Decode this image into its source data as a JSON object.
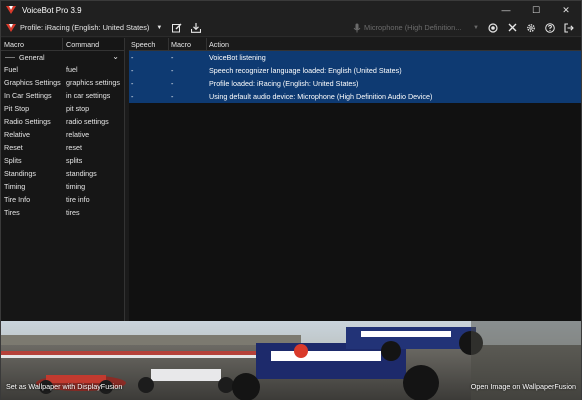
{
  "window": {
    "title": "VoiceBot Pro 3.9"
  },
  "window_controls": {
    "minimize": "—",
    "maximize": "☐",
    "close": "✕"
  },
  "toolbar": {
    "profile_label": "Profile: iRacing (English: United States)",
    "profile_caret": "▼",
    "microphone_label": "Microphone (High Definition...",
    "microphone_caret": "▼"
  },
  "macros": {
    "headers": {
      "macro": "Macro",
      "command": "Command"
    },
    "group": {
      "label": "General",
      "chevron": "⌄"
    },
    "rows": [
      {
        "macro": "Fuel",
        "command": "fuel"
      },
      {
        "macro": "Graphics Settings",
        "command": "graphics settings"
      },
      {
        "macro": "In Car Settings",
        "command": "in car settings"
      },
      {
        "macro": "Pit Stop",
        "command": "pit stop"
      },
      {
        "macro": "Radio Settings",
        "command": "radio settings"
      },
      {
        "macro": "Relative",
        "command": "relative"
      },
      {
        "macro": "Reset",
        "command": "reset"
      },
      {
        "macro": "Splits",
        "command": "splits"
      },
      {
        "macro": "Standings",
        "command": "standings"
      },
      {
        "macro": "Timing",
        "command": "timing"
      },
      {
        "macro": "Tire Info",
        "command": "tire info"
      },
      {
        "macro": "Tires",
        "command": "tires"
      }
    ]
  },
  "log": {
    "headers": {
      "speech": "Speech",
      "macro": "Macro",
      "action": "Action"
    },
    "rows": [
      {
        "speech": "-",
        "macro": "-",
        "action": "VoiceBot listening"
      },
      {
        "speech": "-",
        "macro": "-",
        "action": "Speech recognizer language loaded: English (United States)"
      },
      {
        "speech": "-",
        "macro": "-",
        "action": "Profile loaded: iRacing (English: United States)"
      },
      {
        "speech": "-",
        "macro": "-",
        "action": "Using default audio device: Microphone (High Definition Audio Device)"
      }
    ]
  },
  "banner": {
    "left_link": "Set as Wallpaper with DisplayFusion",
    "right_link": "Open Image on WallpaperFusion"
  },
  "colors": {
    "selection": "#0e3a72",
    "background": "#1b1b1b",
    "accent_red": "#d93a2b"
  }
}
